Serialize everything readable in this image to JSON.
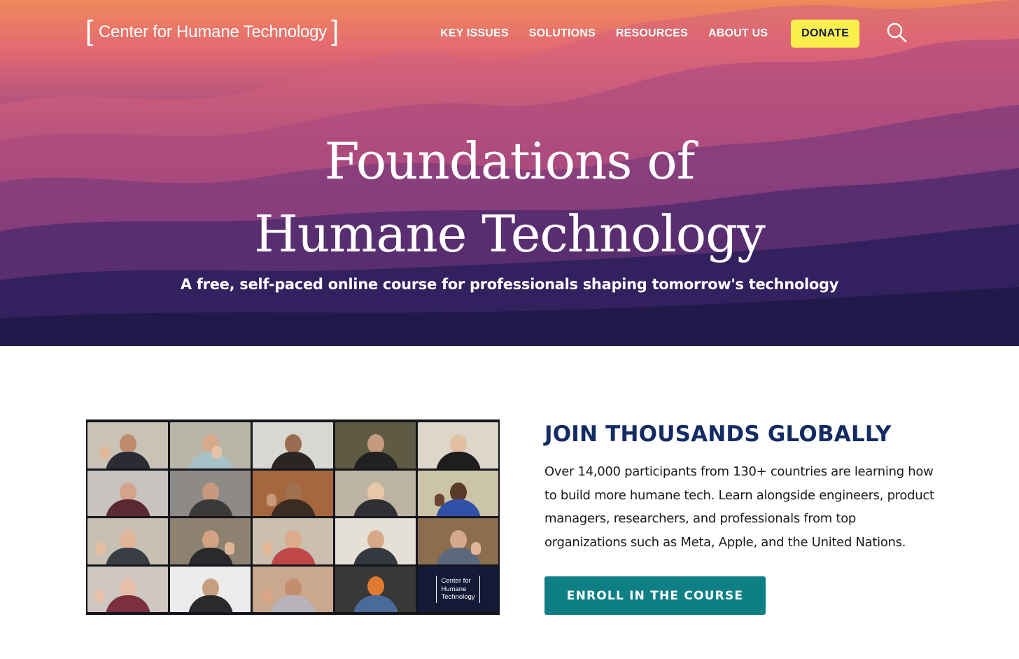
{
  "brand": {
    "name": "Center for Humane Technology"
  },
  "nav": {
    "items": [
      "KEY ISSUES",
      "SOLUTIONS",
      "RESOURCES",
      "ABOUT US"
    ],
    "donate": "DONATE",
    "search_icon": "search-icon"
  },
  "hero": {
    "title_line1": "Foundations of",
    "title_line2": "Humane Technology",
    "subtitle": "A free, self-paced online course for professionals shaping tomorrow's technology"
  },
  "photo": {
    "logo_text": "Center for\nHumane\nTechnology"
  },
  "join": {
    "heading": "JOIN THOUSANDS GLOBALLY",
    "body": "Over 14,000 participants from 130+ countries are learning how to build more humane tech. Learn alongside engineers, product managers, researchers, and professionals from top organizations such as Meta, Apple, and the United Nations.",
    "cta": "ENROLL IN THE COURSE"
  },
  "colors": {
    "donate_bg": "#fbf04b",
    "heading": "#142c64",
    "cta_bg": "#0f7f86"
  }
}
